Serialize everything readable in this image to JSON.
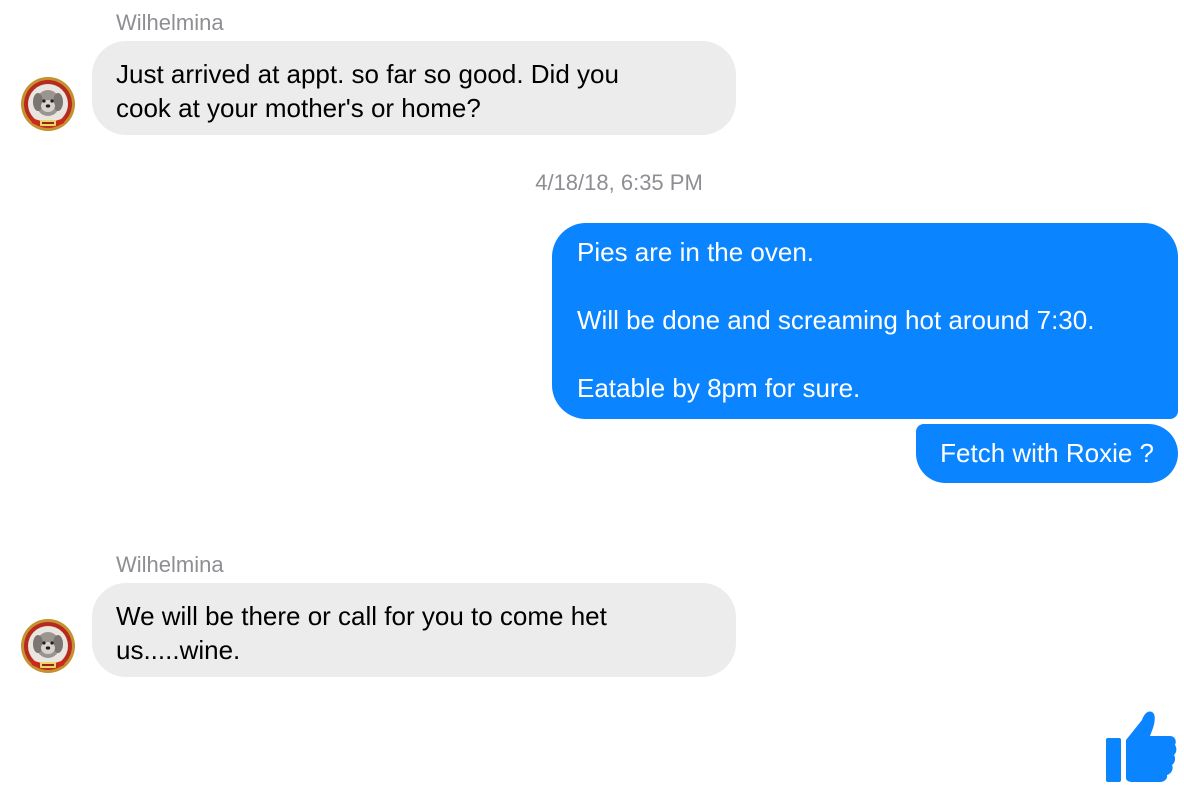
{
  "thread": {
    "group1": {
      "sender": "Wilhelmina",
      "avatar_icon": "pet-dog-avatar",
      "lines": [
        "Just arrived at appt. so far so good. Did you",
        "cook at your mother's or home?"
      ]
    },
    "timestamp": "4/18/18, 6:35 PM",
    "outgoing": {
      "message1": {
        "line1": "Pies are in the oven.",
        "line2": "Will be done and screaming hot around 7:30.",
        "line3": "Eatable by 8pm for sure."
      },
      "message2": "Fetch with Roxie ?"
    },
    "group2": {
      "sender": "Wilhelmina",
      "avatar_icon": "pet-dog-avatar",
      "lines": [
        "We will be there or call for you to come het",
        "us.....wine."
      ]
    }
  },
  "composer": {
    "like_icon": "thumbs-up-icon"
  },
  "colors": {
    "outgoing_bubble": "#0a84ff",
    "incoming_bubble": "#ececec",
    "meta_text": "#8e8e93",
    "like": "#0a84ff"
  }
}
